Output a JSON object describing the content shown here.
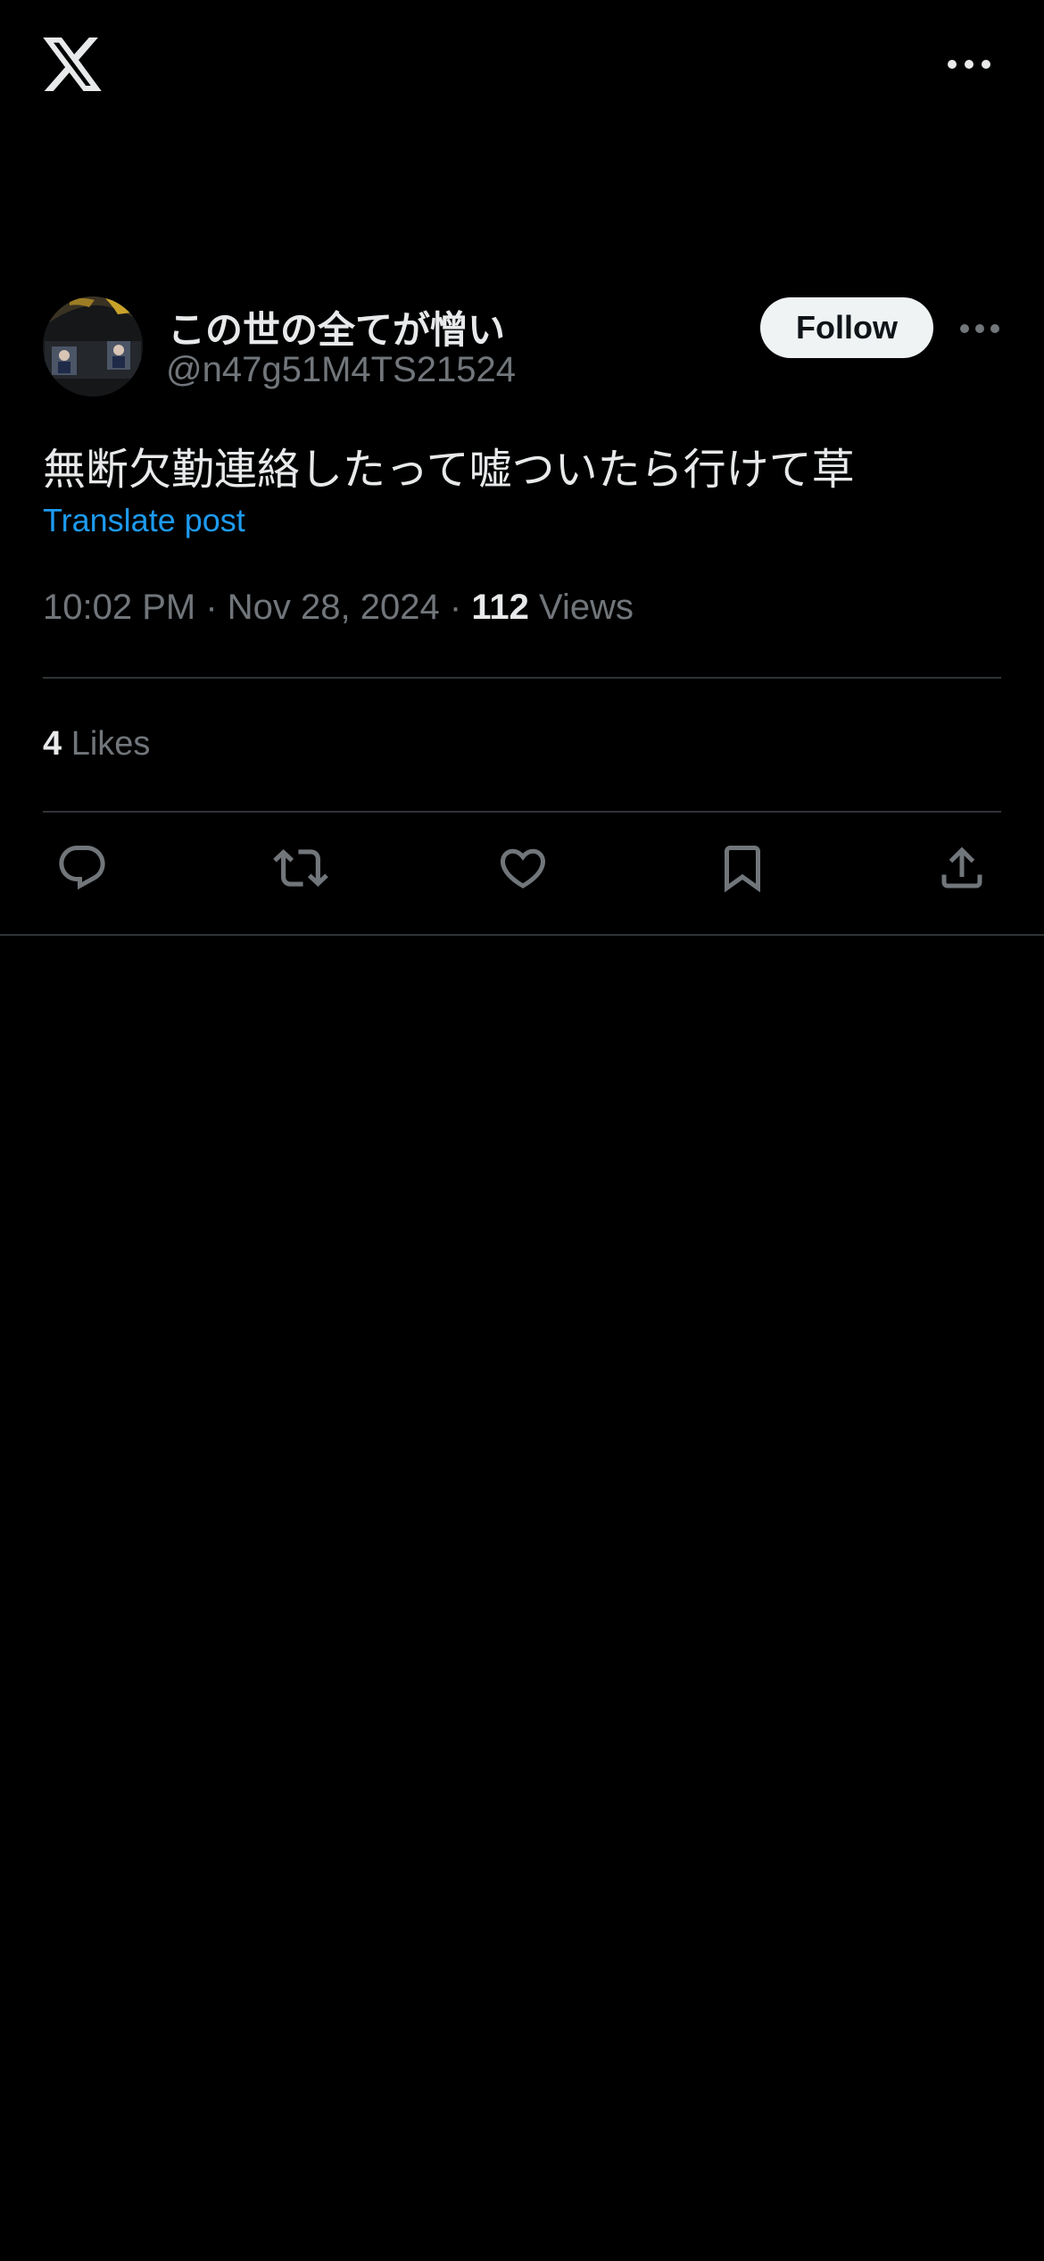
{
  "header": {
    "logo": "x-logo-icon",
    "more_icon": "more-horizontal-icon"
  },
  "post": {
    "author": {
      "display_name": "この世の全てが憎い",
      "handle": "@n47g51M4TS21524",
      "avatar": "avatar-image"
    },
    "follow_label": "Follow",
    "text": "無断欠勤連絡したって嘘ついたら行けて草",
    "translate_label": "Translate post",
    "time": "10:02 PM",
    "separator": "·",
    "date": "Nov 28, 2024",
    "views_count": "112",
    "views_label": "Views",
    "likes_count": "4",
    "likes_label": "Likes"
  },
  "actions": [
    {
      "name": "reply",
      "icon": "reply-icon"
    },
    {
      "name": "repost",
      "icon": "repost-icon"
    },
    {
      "name": "like",
      "icon": "heart-icon"
    },
    {
      "name": "bookmark",
      "icon": "bookmark-icon"
    },
    {
      "name": "share",
      "icon": "share-icon"
    }
  ],
  "colors": {
    "background": "#000000",
    "text_primary": "#e7e9ea",
    "text_secondary": "#71767b",
    "link": "#1d9bf0",
    "divider": "#2f3336",
    "follow_bg": "#eff3f4"
  }
}
